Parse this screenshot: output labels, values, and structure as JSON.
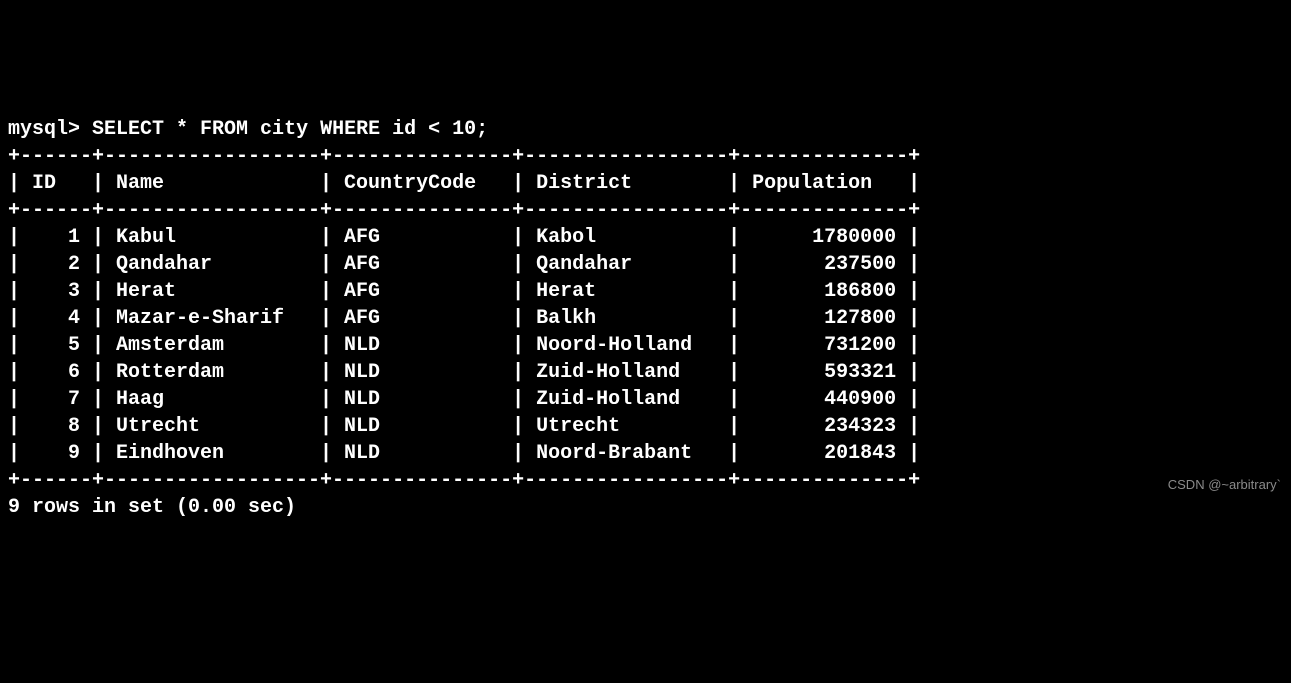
{
  "prompt": "mysql>",
  "query": "SELECT * FROM city WHERE id < 10;",
  "table": {
    "columns": [
      "ID",
      "Name",
      "CountryCode",
      "District",
      "Population"
    ],
    "widths": [
      4,
      16,
      13,
      15,
      12
    ],
    "align": [
      "right",
      "left",
      "left",
      "left",
      "right"
    ],
    "rows": [
      {
        "ID": 1,
        "Name": "Kabul",
        "CountryCode": "AFG",
        "District": "Kabol",
        "Population": 1780000
      },
      {
        "ID": 2,
        "Name": "Qandahar",
        "CountryCode": "AFG",
        "District": "Qandahar",
        "Population": 237500
      },
      {
        "ID": 3,
        "Name": "Herat",
        "CountryCode": "AFG",
        "District": "Herat",
        "Population": 186800
      },
      {
        "ID": 4,
        "Name": "Mazar-e-Sharif",
        "CountryCode": "AFG",
        "District": "Balkh",
        "Population": 127800
      },
      {
        "ID": 5,
        "Name": "Amsterdam",
        "CountryCode": "NLD",
        "District": "Noord-Holland",
        "Population": 731200
      },
      {
        "ID": 6,
        "Name": "Rotterdam",
        "CountryCode": "NLD",
        "District": "Zuid-Holland",
        "Population": 593321
      },
      {
        "ID": 7,
        "Name": "Haag",
        "CountryCode": "NLD",
        "District": "Zuid-Holland",
        "Population": 440900
      },
      {
        "ID": 8,
        "Name": "Utrecht",
        "CountryCode": "NLD",
        "District": "Utrecht",
        "Population": 234323
      },
      {
        "ID": 9,
        "Name": "Eindhoven",
        "CountryCode": "NLD",
        "District": "Noord-Brabant",
        "Population": 201843
      }
    ]
  },
  "result_summary": "9 rows in set (0.00 sec)",
  "watermark": "CSDN @~arbitrary`"
}
